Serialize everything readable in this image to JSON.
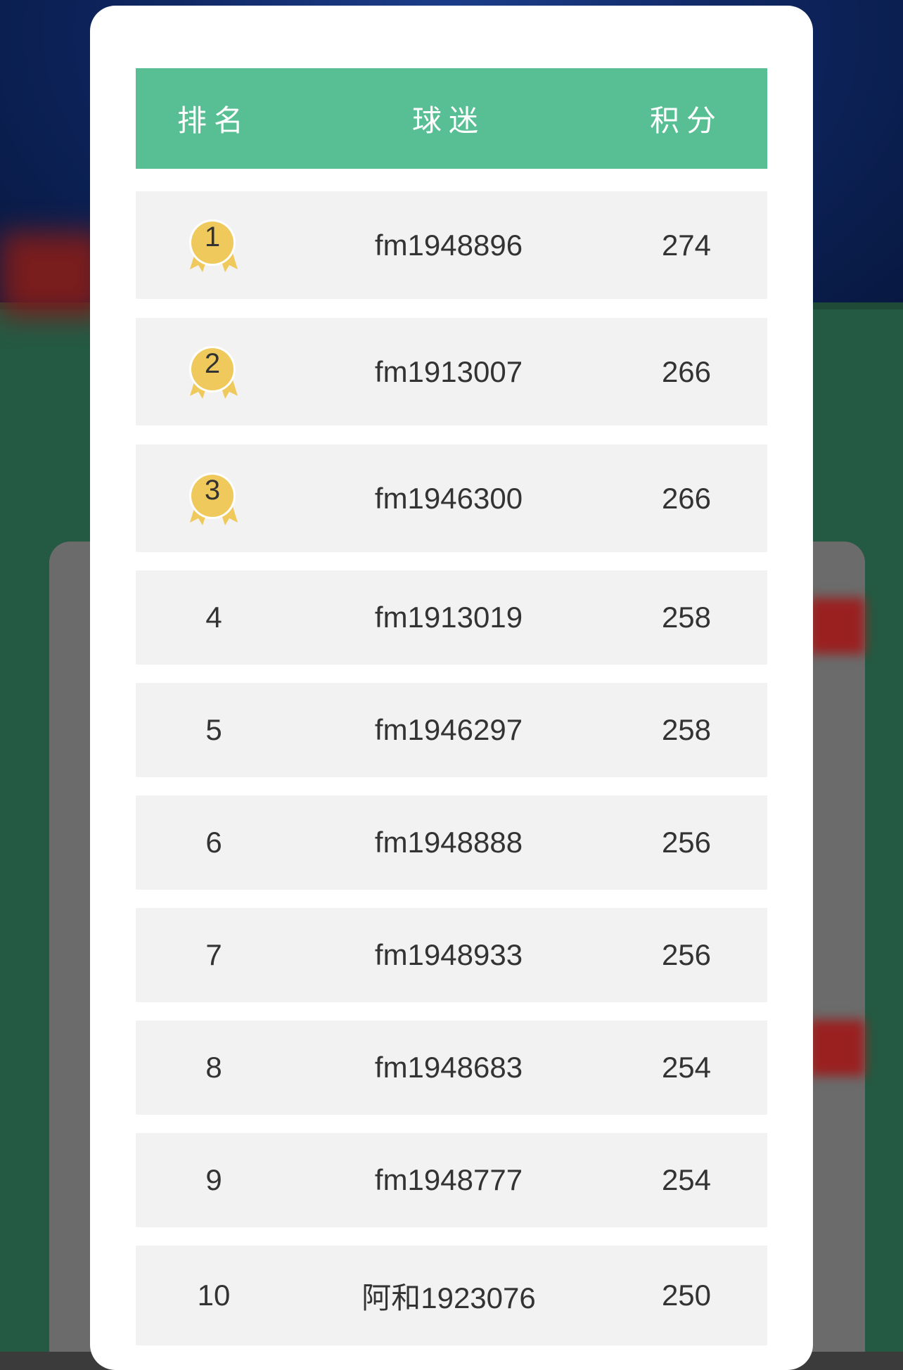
{
  "header": {
    "rank_label": "排名",
    "fan_label": "球迷",
    "score_label": "积分"
  },
  "rows": [
    {
      "rank": "1",
      "name": "fm1948896",
      "score": "274",
      "medal": true
    },
    {
      "rank": "2",
      "name": "fm1913007",
      "score": "266",
      "medal": true
    },
    {
      "rank": "3",
      "name": "fm1946300",
      "score": "266",
      "medal": true
    },
    {
      "rank": "4",
      "name": "fm1913019",
      "score": "258",
      "medal": false
    },
    {
      "rank": "5",
      "name": "fm1946297",
      "score": "258",
      "medal": false
    },
    {
      "rank": "6",
      "name": "fm1948888",
      "score": "256",
      "medal": false
    },
    {
      "rank": "7",
      "name": "fm1948933",
      "score": "256",
      "medal": false
    },
    {
      "rank": "8",
      "name": "fm1948683",
      "score": "254",
      "medal": false
    },
    {
      "rank": "9",
      "name": "fm1948777",
      "score": "254",
      "medal": false
    },
    {
      "rank": "10",
      "name": "阿和1923076",
      "score": "250",
      "medal": false
    }
  ],
  "colors": {
    "header_bg": "#57bf93",
    "row_bg": "#f2f2f2",
    "medal_gold": "#efc95c"
  },
  "icons": {
    "medal": "medal-icon"
  }
}
